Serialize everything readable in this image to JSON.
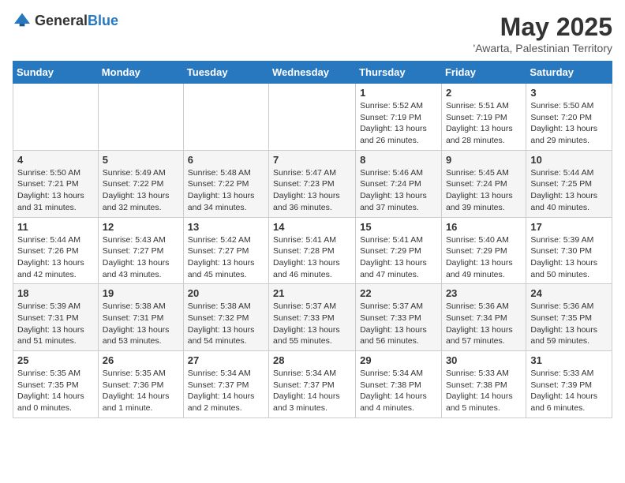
{
  "logo": {
    "general": "General",
    "blue": "Blue"
  },
  "header": {
    "month": "May 2025",
    "location": "'Awarta, Palestinian Territory"
  },
  "weekdays": [
    "Sunday",
    "Monday",
    "Tuesday",
    "Wednesday",
    "Thursday",
    "Friday",
    "Saturday"
  ],
  "weeks": [
    [
      {
        "day": "",
        "info": ""
      },
      {
        "day": "",
        "info": ""
      },
      {
        "day": "",
        "info": ""
      },
      {
        "day": "",
        "info": ""
      },
      {
        "day": "1",
        "info": "Sunrise: 5:52 AM\nSunset: 7:19 PM\nDaylight: 13 hours and 26 minutes."
      },
      {
        "day": "2",
        "info": "Sunrise: 5:51 AM\nSunset: 7:19 PM\nDaylight: 13 hours and 28 minutes."
      },
      {
        "day": "3",
        "info": "Sunrise: 5:50 AM\nSunset: 7:20 PM\nDaylight: 13 hours and 29 minutes."
      }
    ],
    [
      {
        "day": "4",
        "info": "Sunrise: 5:50 AM\nSunset: 7:21 PM\nDaylight: 13 hours and 31 minutes."
      },
      {
        "day": "5",
        "info": "Sunrise: 5:49 AM\nSunset: 7:22 PM\nDaylight: 13 hours and 32 minutes."
      },
      {
        "day": "6",
        "info": "Sunrise: 5:48 AM\nSunset: 7:22 PM\nDaylight: 13 hours and 34 minutes."
      },
      {
        "day": "7",
        "info": "Sunrise: 5:47 AM\nSunset: 7:23 PM\nDaylight: 13 hours and 36 minutes."
      },
      {
        "day": "8",
        "info": "Sunrise: 5:46 AM\nSunset: 7:24 PM\nDaylight: 13 hours and 37 minutes."
      },
      {
        "day": "9",
        "info": "Sunrise: 5:45 AM\nSunset: 7:24 PM\nDaylight: 13 hours and 39 minutes."
      },
      {
        "day": "10",
        "info": "Sunrise: 5:44 AM\nSunset: 7:25 PM\nDaylight: 13 hours and 40 minutes."
      }
    ],
    [
      {
        "day": "11",
        "info": "Sunrise: 5:44 AM\nSunset: 7:26 PM\nDaylight: 13 hours and 42 minutes."
      },
      {
        "day": "12",
        "info": "Sunrise: 5:43 AM\nSunset: 7:27 PM\nDaylight: 13 hours and 43 minutes."
      },
      {
        "day": "13",
        "info": "Sunrise: 5:42 AM\nSunset: 7:27 PM\nDaylight: 13 hours and 45 minutes."
      },
      {
        "day": "14",
        "info": "Sunrise: 5:41 AM\nSunset: 7:28 PM\nDaylight: 13 hours and 46 minutes."
      },
      {
        "day": "15",
        "info": "Sunrise: 5:41 AM\nSunset: 7:29 PM\nDaylight: 13 hours and 47 minutes."
      },
      {
        "day": "16",
        "info": "Sunrise: 5:40 AM\nSunset: 7:29 PM\nDaylight: 13 hours and 49 minutes."
      },
      {
        "day": "17",
        "info": "Sunrise: 5:39 AM\nSunset: 7:30 PM\nDaylight: 13 hours and 50 minutes."
      }
    ],
    [
      {
        "day": "18",
        "info": "Sunrise: 5:39 AM\nSunset: 7:31 PM\nDaylight: 13 hours and 51 minutes."
      },
      {
        "day": "19",
        "info": "Sunrise: 5:38 AM\nSunset: 7:31 PM\nDaylight: 13 hours and 53 minutes."
      },
      {
        "day": "20",
        "info": "Sunrise: 5:38 AM\nSunset: 7:32 PM\nDaylight: 13 hours and 54 minutes."
      },
      {
        "day": "21",
        "info": "Sunrise: 5:37 AM\nSunset: 7:33 PM\nDaylight: 13 hours and 55 minutes."
      },
      {
        "day": "22",
        "info": "Sunrise: 5:37 AM\nSunset: 7:33 PM\nDaylight: 13 hours and 56 minutes."
      },
      {
        "day": "23",
        "info": "Sunrise: 5:36 AM\nSunset: 7:34 PM\nDaylight: 13 hours and 57 minutes."
      },
      {
        "day": "24",
        "info": "Sunrise: 5:36 AM\nSunset: 7:35 PM\nDaylight: 13 hours and 59 minutes."
      }
    ],
    [
      {
        "day": "25",
        "info": "Sunrise: 5:35 AM\nSunset: 7:35 PM\nDaylight: 14 hours and 0 minutes."
      },
      {
        "day": "26",
        "info": "Sunrise: 5:35 AM\nSunset: 7:36 PM\nDaylight: 14 hours and 1 minute."
      },
      {
        "day": "27",
        "info": "Sunrise: 5:34 AM\nSunset: 7:37 PM\nDaylight: 14 hours and 2 minutes."
      },
      {
        "day": "28",
        "info": "Sunrise: 5:34 AM\nSunset: 7:37 PM\nDaylight: 14 hours and 3 minutes."
      },
      {
        "day": "29",
        "info": "Sunrise: 5:34 AM\nSunset: 7:38 PM\nDaylight: 14 hours and 4 minutes."
      },
      {
        "day": "30",
        "info": "Sunrise: 5:33 AM\nSunset: 7:38 PM\nDaylight: 14 hours and 5 minutes."
      },
      {
        "day": "31",
        "info": "Sunrise: 5:33 AM\nSunset: 7:39 PM\nDaylight: 14 hours and 6 minutes."
      }
    ]
  ]
}
